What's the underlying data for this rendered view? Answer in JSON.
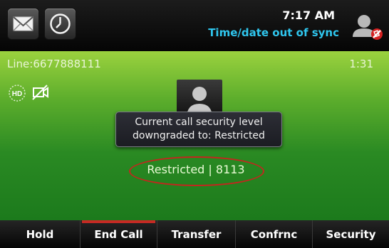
{
  "status": {
    "time": "7:17 AM",
    "sync_warning": "Time/date out of sync",
    "icons": [
      "messages-icon",
      "clock-icon",
      "user-status-icon"
    ]
  },
  "call": {
    "line": "Line:6677888111",
    "timer": "1:31",
    "hd_icon": "hd-audio-icon",
    "video_icon": "video-off-icon",
    "security_info": "Restricted | 8113",
    "highlight_color": "#c3261e"
  },
  "notification": {
    "line1": "Current call security level",
    "line2": "downgraded to: Restricted"
  },
  "softkeys": {
    "hold": "Hold",
    "end_call": "End Call",
    "transfer": "Transfer",
    "conference": "Confrnc",
    "security": "Security",
    "end_call_accent": "#c62a24"
  }
}
